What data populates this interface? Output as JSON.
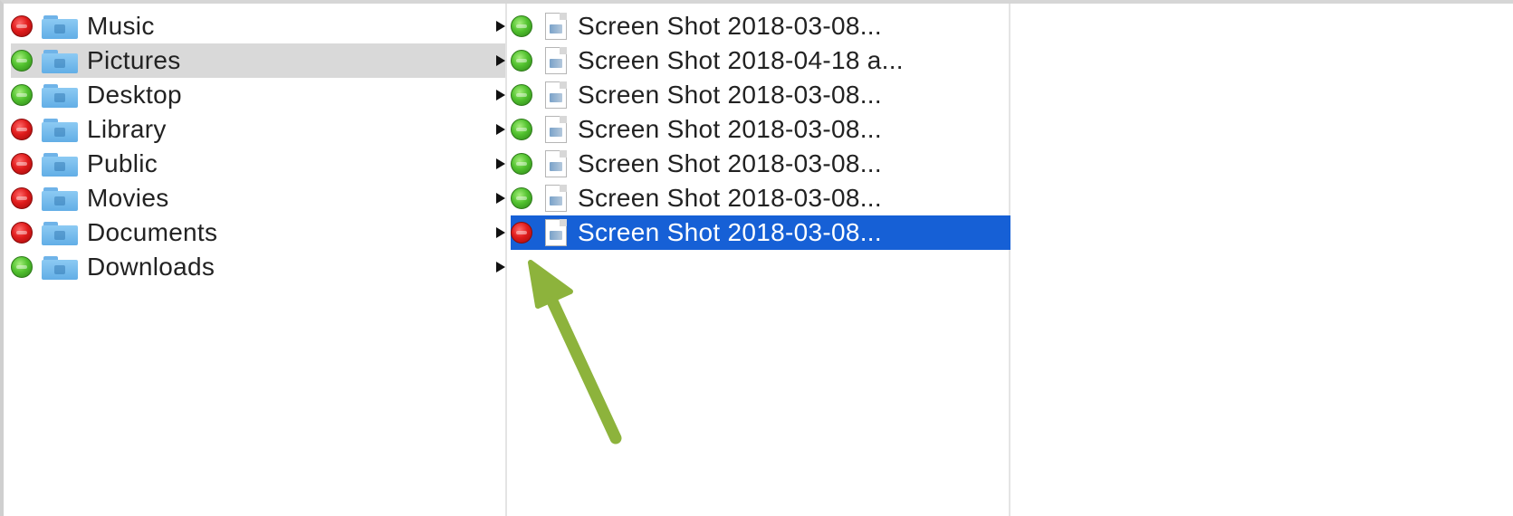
{
  "columns": {
    "folders": [
      {
        "label": "Music",
        "tag": "red"
      },
      {
        "label": "Pictures",
        "tag": "green"
      },
      {
        "label": "Desktop",
        "tag": "green"
      },
      {
        "label": "Library",
        "tag": "red"
      },
      {
        "label": "Public",
        "tag": "red"
      },
      {
        "label": "Movies",
        "tag": "red"
      },
      {
        "label": "Documents",
        "tag": "red"
      },
      {
        "label": "Downloads",
        "tag": "green"
      }
    ],
    "files": [
      {
        "label": "Screen Shot 2018-03-08...",
        "tag": "green"
      },
      {
        "label": "Screen Shot 2018-04-18 a...",
        "tag": "green"
      },
      {
        "label": "Screen Shot 2018-03-08...",
        "tag": "green"
      },
      {
        "label": "Screen Shot 2018-03-08...",
        "tag": "green"
      },
      {
        "label": "Screen Shot 2018-03-08...",
        "tag": "green"
      },
      {
        "label": "Screen Shot 2018-03-08...",
        "tag": "green"
      },
      {
        "label": "Screen Shot 2018-03-08...",
        "tag": "red"
      }
    ]
  },
  "state": {
    "highlighted_folder": "Pictures",
    "selected_file_index": 6
  },
  "colors": {
    "selection": "#1660d6",
    "highlight": "#d9d9d9",
    "tag_red": "#e01c1c",
    "tag_green": "#52c22f",
    "callout_arrow": "#8db33c"
  },
  "icons": {
    "folder": "folder-icon",
    "file": "image-file-icon",
    "disclosure": "disclosure-arrow-icon",
    "status_red": "status-red-icon",
    "status_green": "status-green-icon",
    "callout": "callout-arrow-icon"
  }
}
